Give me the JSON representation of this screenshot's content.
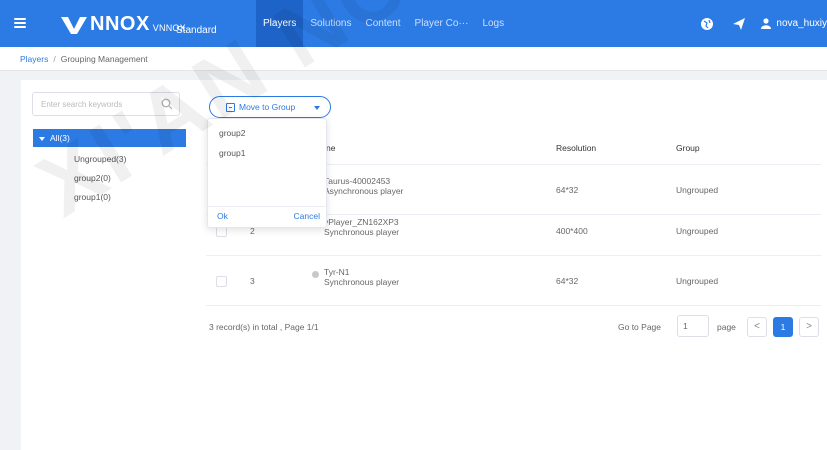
{
  "topbar": {
    "logo_text": "NNOX",
    "logo_sub": "VNNOX",
    "edition": "Standard",
    "nav": [
      "Players",
      "Solutions",
      "Content",
      "Player Co···",
      "Logs"
    ],
    "user": "nova_huxiy",
    "accent": "#2c7be5"
  },
  "breadcrumb": {
    "root": "Players",
    "current": "Grouping Management"
  },
  "left": {
    "search_placeholder": "Enter search keywords",
    "tree_all": "All(3)",
    "tree_items": [
      "Ungrouped(3)",
      "group2(0)",
      "group1(0)"
    ]
  },
  "toolbar": {
    "move_to_group": "Move to Group"
  },
  "dropdown": {
    "items": [
      "group2",
      "group1"
    ],
    "ok": "Ok",
    "cancel": "Cancel"
  },
  "table": {
    "headers": {
      "name": "ne",
      "resolution": "Resolution",
      "group": "Group"
    },
    "rows": [
      {
        "no": "",
        "name": "Taurus-40002453",
        "type": "Asynchronous player",
        "resolution": "64*32",
        "group": "Ungrouped"
      },
      {
        "no": "2",
        "name": "vPlayer_ZN162XP3",
        "type": "Synchronous player",
        "resolution": "400*400",
        "group": "Ungrouped"
      },
      {
        "no": "3",
        "name": "Tyr-N1",
        "type": "Synchronous player",
        "resolution": "64*32",
        "group": "Ungrouped"
      }
    ]
  },
  "footer": {
    "total": "3 record(s) in total , Page 1/1",
    "goto": "Go to Page",
    "page_value": "1",
    "page_word": "page",
    "current_page": "1",
    "prev": "<",
    "next": ">"
  },
  "watermark": "XI'AN NOVA"
}
